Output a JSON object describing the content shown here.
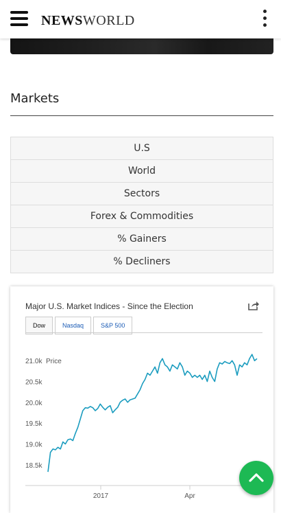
{
  "header": {
    "logo_main": "NEWS",
    "logo_sub": "WORLD"
  },
  "markets": {
    "title": "Markets",
    "tabs": [
      "U.S",
      "World",
      "Sectors",
      "Forex & Commodities",
      "% Gainers",
      "% Decliners"
    ]
  },
  "chart_card": {
    "title": "Major U.S. Market Indices - Since the Election",
    "tabs": [
      "Dow",
      "Nasdaq",
      "S&P 500"
    ],
    "active_tab": "Dow",
    "price_label": "Price",
    "accent": "#1a9cbf"
  },
  "chart_data": {
    "type": "line",
    "title": "Major U.S. Market Indices - Since the Election",
    "ylabel": "Price",
    "ylim": [
      18200,
      21300
    ],
    "y_ticks": [
      "18.5k",
      "19.0k",
      "19.5k",
      "20.0k",
      "20.5k",
      "21.0k"
    ],
    "y_tick_values": [
      18500,
      19000,
      19500,
      20000,
      20500,
      21000
    ],
    "x_ticks": [
      "2017",
      "Apr"
    ],
    "series": [
      {
        "values": [
          18330,
          18800,
          18880,
          18860,
          18920,
          18880,
          19050,
          19000,
          19100,
          19120,
          19080,
          19250,
          19400,
          19600,
          19800,
          19870,
          19860,
          19900,
          19870,
          19800,
          19850,
          19960,
          19880,
          19820,
          19880,
          19920,
          19750,
          19820,
          19880,
          20000,
          20050,
          20080,
          20000,
          20060,
          20080,
          20100,
          20200,
          20300,
          20450,
          20550,
          20700,
          20650,
          20750,
          20850,
          20700,
          20950,
          21050,
          20900,
          20850,
          20750,
          20900,
          20850,
          20800,
          20950,
          20850,
          20650,
          20750,
          20700,
          20600,
          20650,
          20600,
          20650,
          20550,
          20650,
          20500,
          20750,
          20600,
          20500,
          20800,
          20950,
          20920,
          20980,
          20950,
          20930,
          21000,
          20900,
          20650,
          20900,
          20850,
          20950,
          20900,
          21050,
          21150,
          21000,
          21050
        ]
      }
    ],
    "grid": false,
    "legend": "none"
  },
  "nav": {
    "back_to_top": "back-to-top"
  }
}
